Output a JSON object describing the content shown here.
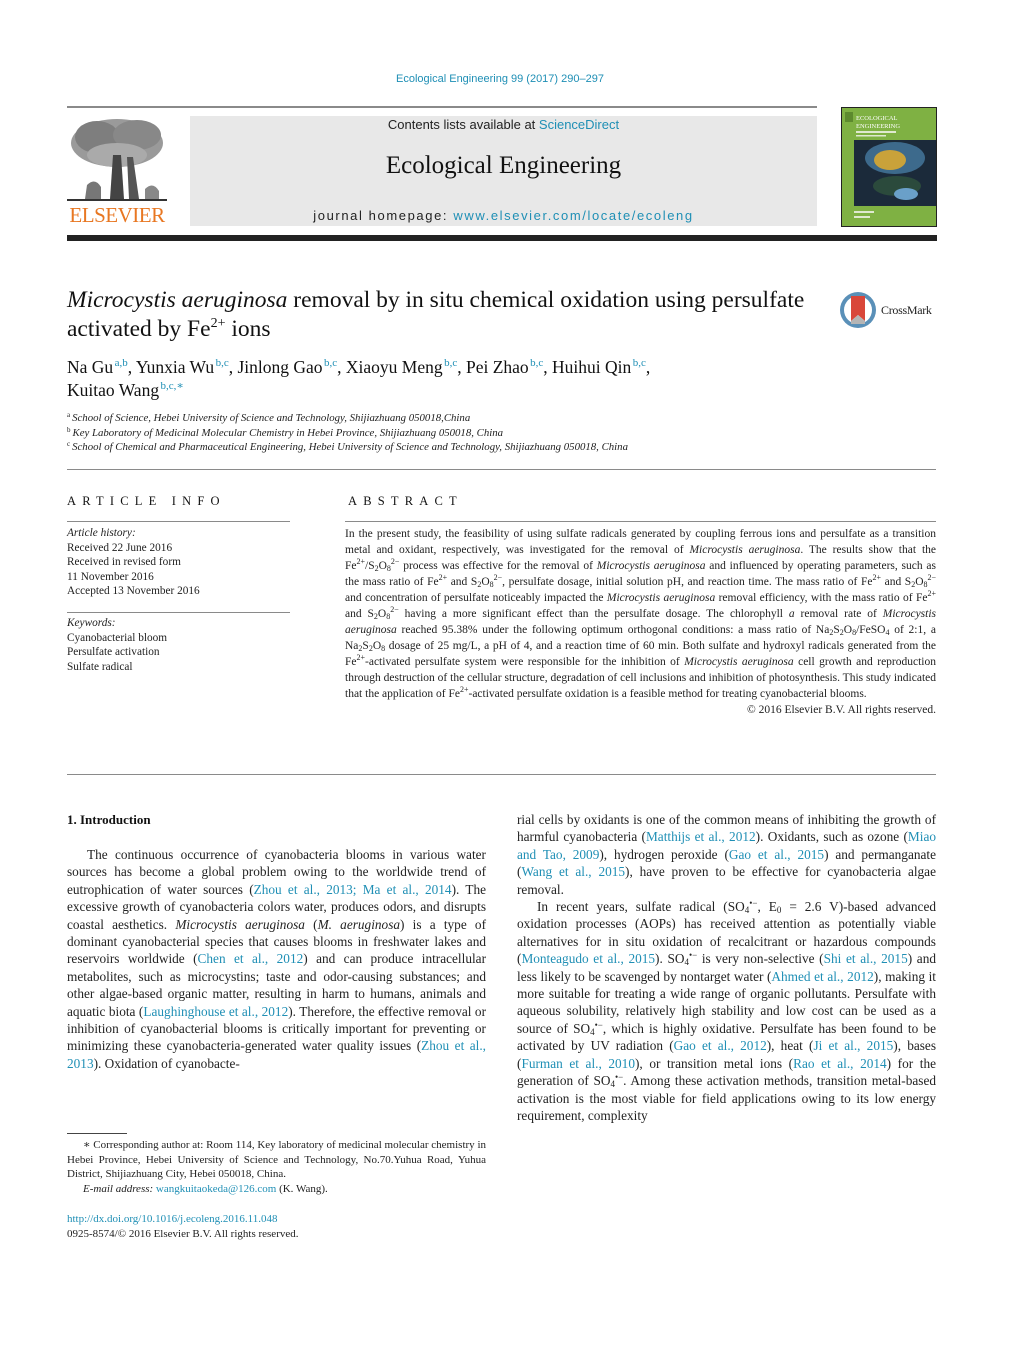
{
  "header": {
    "journal_ref": "Ecological Engineering 99 (2017) 290–297",
    "contents_prefix": "Contents lists available at ",
    "contents_link": "ScienceDirect",
    "journal_title": "Ecological Engineering",
    "homepage_prefix": "journal homepage: ",
    "homepage_link": "www.elsevier.com/locate/ecoleng",
    "publisher_logo": "ELSEVIER",
    "cover_title_line1": "ECOLOGICAL",
    "cover_title_line2": "ENGINEERING",
    "colors": {
      "link": "#1f8fb5",
      "elsevier_orange": "#e87722",
      "cover_green": "#7fb143"
    }
  },
  "crossmark": {
    "label": "CrossMark",
    "icon": "crossmark-icon"
  },
  "article": {
    "title_italic": "Microcystis aeruginosa",
    "title_rest": " removal by in situ chemical oxidation using persulfate activated by Fe",
    "title_sup": "2+",
    "title_end": " ions",
    "authors": [
      {
        "name": "Na Gu",
        "aff": "a,b"
      },
      {
        "name": "Yunxia Wu",
        "aff": "b,c"
      },
      {
        "name": "Jinlong Gao",
        "aff": "b,c"
      },
      {
        "name": "Xiaoyu Meng",
        "aff": "b,c"
      },
      {
        "name": "Pei Zhao",
        "aff": "b,c"
      },
      {
        "name": "Huihui Qin",
        "aff": "b,c"
      },
      {
        "name": "Kuitao Wang",
        "aff": "b,c,∗"
      }
    ],
    "affiliations": [
      {
        "key": "a",
        "text": "School of Science, Hebei University of Science and Technology, Shijiazhuang 050018,China"
      },
      {
        "key": "b",
        "text": "Key Laboratory of Medicinal Molecular Chemistry in Hebei Province, Shijiazhuang 050018, China"
      },
      {
        "key": "c",
        "text": "School of Chemical and Pharmaceutical Engineering, Hebei University of Science and Technology, Shijiazhuang 050018, China"
      }
    ]
  },
  "article_info": {
    "heading": "ARTICLE INFO",
    "history_label": "Article history:",
    "history": [
      "Received 22 June 2016",
      "Received in revised form",
      "11 November 2016",
      "Accepted 13 November 2016"
    ],
    "keywords_label": "Keywords:",
    "keywords": [
      "Cyanobacterial bloom",
      "Persulfate activation",
      "Sulfate radical"
    ]
  },
  "abstract": {
    "heading": "ABSTRACT",
    "copyright": "© 2016 Elsevier B.V. All rights reserved."
  },
  "body": {
    "section_heading": "1.  Introduction",
    "links": {
      "zhou_ma": "Zhou et al., 2013; Ma et al., 2014",
      "chen": "Chen et al., 2012",
      "laughinghouse": "Laughinghouse et al., 2012",
      "zhou": "Zhou et al., 2013",
      "matthijs": "Matthijs et al., 2012",
      "miao": "Miao and Tao, 2009",
      "gao2015": "Gao et al., 2015",
      "wang2015": "Wang et al., 2015",
      "monteagudo": "Monteagudo et al., 2015",
      "shi": "Shi et al., 2015",
      "ahmed": "Ahmed et al., 2012",
      "gao2012": "Gao et al., 2012",
      "ji": "Ji et al., 2015",
      "furman": "Furman et al., 2010",
      "rao": "Rao et al., 2014"
    }
  },
  "footnote": {
    "corresponding": "∗  Corresponding author at: Room 114, Key laboratory of medicinal molecular chemistry in Hebei Province, Hebei University of Science and Technology, No.70.Yuhua Road, Yuhua District, Shijiazhuang City, Hebei 050018, China.",
    "email_label": "E-mail address: ",
    "email": "wangkuitaokeda@126.com",
    "email_suffix": " (K. Wang).",
    "doi": "http://dx.doi.org/10.1016/j.ecoleng.2016.11.048",
    "issn_line": "0925-8574/© 2016 Elsevier B.V. All rights reserved."
  }
}
